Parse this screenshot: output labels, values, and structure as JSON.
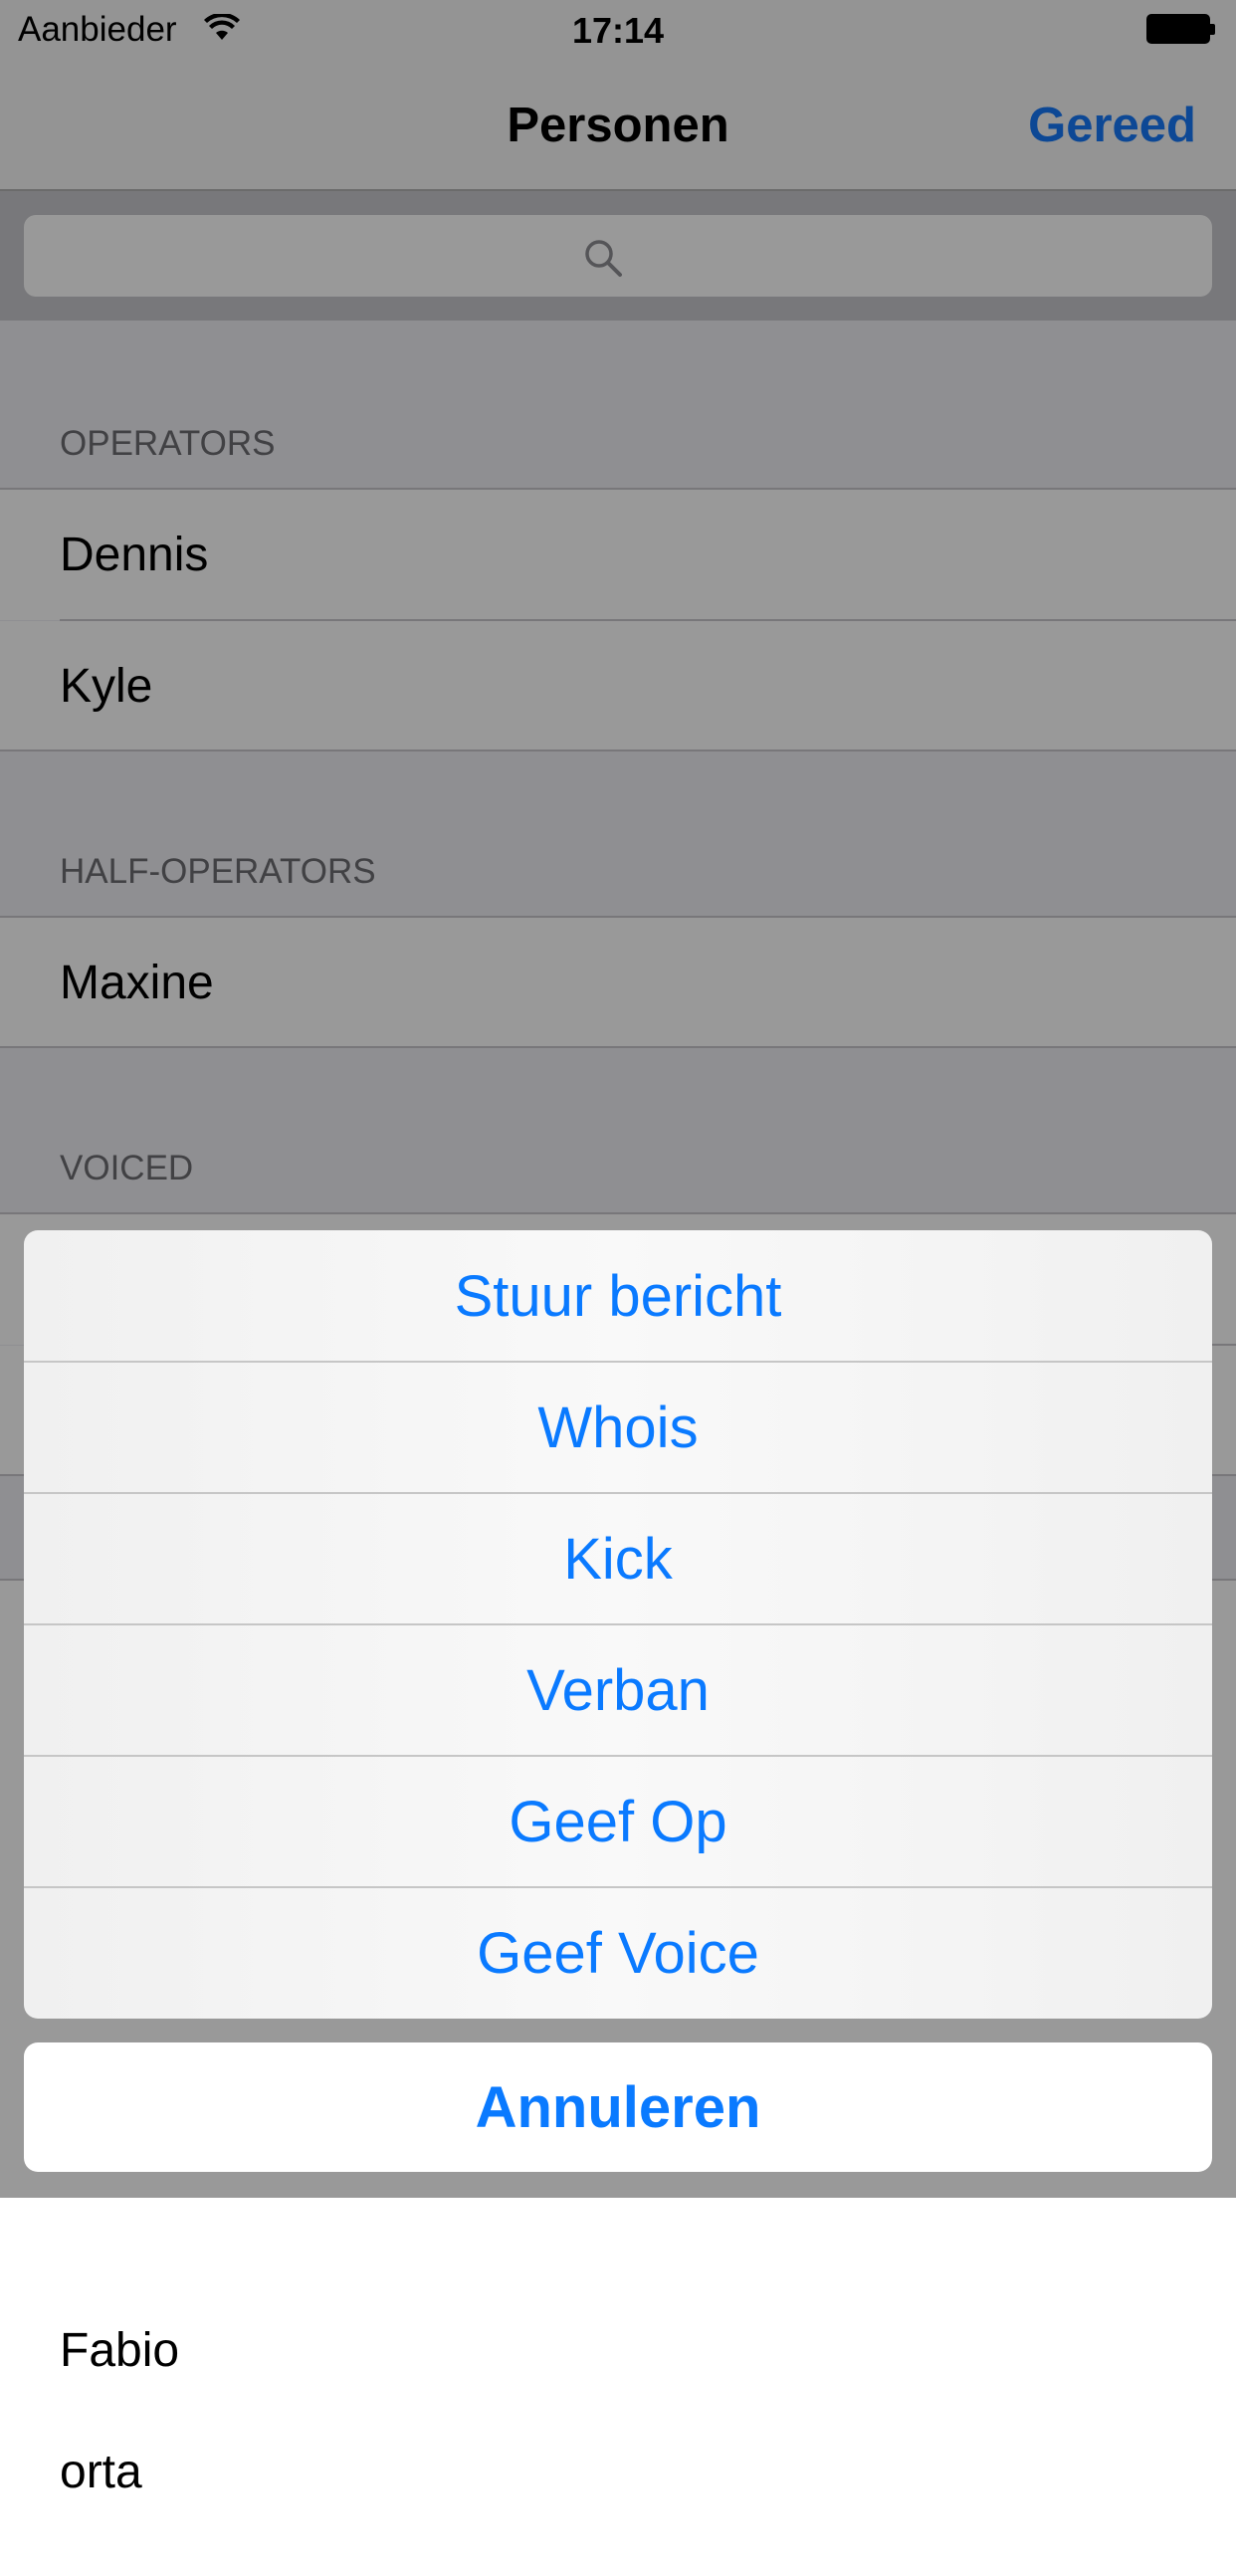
{
  "status_bar": {
    "carrier": "Aanbieder",
    "time": "17:14"
  },
  "nav": {
    "title": "Personen",
    "done_label": "Gereed"
  },
  "search": {
    "placeholder": ""
  },
  "sections": [
    {
      "header": "OPERATORS",
      "rows": [
        "Dennis",
        "Kyle"
      ]
    },
    {
      "header": "HALF-OPERATORS",
      "rows": [
        "Maxine"
      ]
    },
    {
      "header": "VOICED",
      "rows": []
    }
  ],
  "background_rows": [
    "Fabio",
    "orta"
  ],
  "action_sheet": {
    "actions": [
      "Stuur bericht",
      "Whois",
      "Kick",
      "Verban",
      "Geef Op",
      "Geef Voice"
    ],
    "cancel_label": "Annuleren"
  },
  "colors": {
    "accent": "#0a7aff",
    "section_header": "#6d6d72"
  }
}
